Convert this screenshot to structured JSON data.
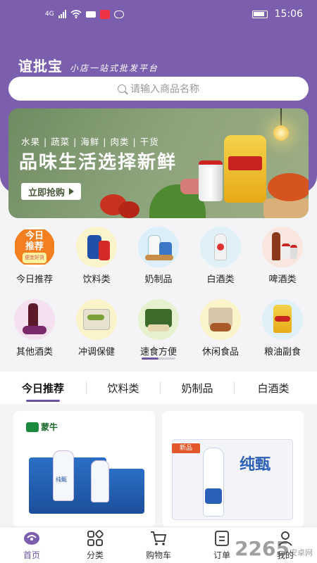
{
  "status_bar": {
    "network": "4G",
    "time": "15:06"
  },
  "brand": {
    "name": "谊批宝",
    "slogan": "小店一站式批发平台"
  },
  "search": {
    "placeholder": "请输入商品名称"
  },
  "banner": {
    "tags": "水果 | 蔬菜 | 海鲜 | 肉类 | 干货",
    "title": "品味生活选择新鲜",
    "button_label": "立即抢购"
  },
  "categories": [
    [
      {
        "label": "今日推荐",
        "icon": "today-recommend-icon",
        "badge_line1": "今日",
        "badge_line2": "推荐",
        "badge_small": "便宜好货"
      },
      {
        "label": "饮料类",
        "icon": "beverage-icon"
      },
      {
        "label": "奶制品",
        "icon": "dairy-icon"
      },
      {
        "label": "白酒类",
        "icon": "baijiu-icon"
      },
      {
        "label": "啤酒类",
        "icon": "beer-icon"
      }
    ],
    [
      {
        "label": "其他酒类",
        "icon": "wine-icon"
      },
      {
        "label": "冲调保健",
        "icon": "health-drink-icon"
      },
      {
        "label": "速食方便",
        "icon": "instant-food-icon"
      },
      {
        "label": "休闲食品",
        "icon": "snack-icon"
      },
      {
        "label": "粮油副食",
        "icon": "grain-oil-icon"
      }
    ]
  ],
  "tabs": [
    "今日推荐",
    "饮料类",
    "奶制品",
    "白酒类"
  ],
  "products": [
    {
      "brand_logo": "蒙牛",
      "box_text": "纯甄"
    },
    {
      "brand_text": "纯甄",
      "promo": "新品"
    }
  ],
  "bottom_nav": [
    {
      "label": "首页",
      "icon": "home-icon",
      "active": true
    },
    {
      "label": "分类",
      "icon": "category-icon",
      "active": false
    },
    {
      "label": "购物车",
      "icon": "cart-icon",
      "active": false
    },
    {
      "label": "订单",
      "icon": "order-icon",
      "active": false
    },
    {
      "label": "我的",
      "icon": "profile-icon",
      "active": false
    }
  ],
  "watermark": {
    "number": "2265",
    "suffix": "安卓网"
  },
  "colors": {
    "primary": "#7b5fae",
    "accent_tab": "#6c55a3",
    "badge_orange": "#f37f21"
  }
}
